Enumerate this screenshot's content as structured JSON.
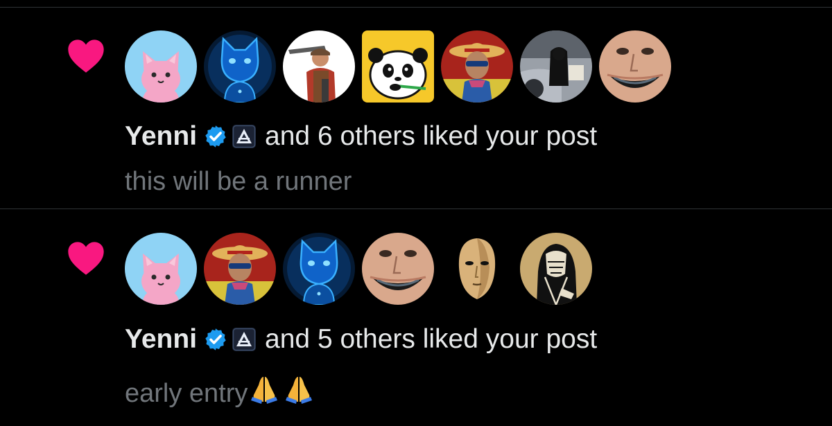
{
  "colors": {
    "background": "#000000",
    "heart": "#f91880",
    "text": "#e7e9ea",
    "muted": "#71767b",
    "verified": "#1d9bf0",
    "divider": "#2f3336"
  },
  "notifications": [
    {
      "icon": "heart-icon",
      "user": "Yenni",
      "verified": true,
      "action_text": "and 6 others liked your post",
      "snippet": "this will be a runner",
      "avatars": [
        "pink-cat",
        "blue-cat",
        "soldier-sniper",
        "panda",
        "straw-hat-man",
        "hooded-figure-car",
        "black-teeth-grin"
      ]
    },
    {
      "icon": "heart-icon",
      "user": "Yenni",
      "verified": true,
      "action_text": "and 5 others liked your post",
      "snippet": "early entry",
      "snippet_emoji": [
        "folded-hands",
        "folded-hands"
      ],
      "avatars": [
        "pink-cat",
        "straw-hat-man",
        "blue-cat",
        "black-teeth-grin",
        "gold-mask",
        "hooded-sketch"
      ]
    }
  ]
}
